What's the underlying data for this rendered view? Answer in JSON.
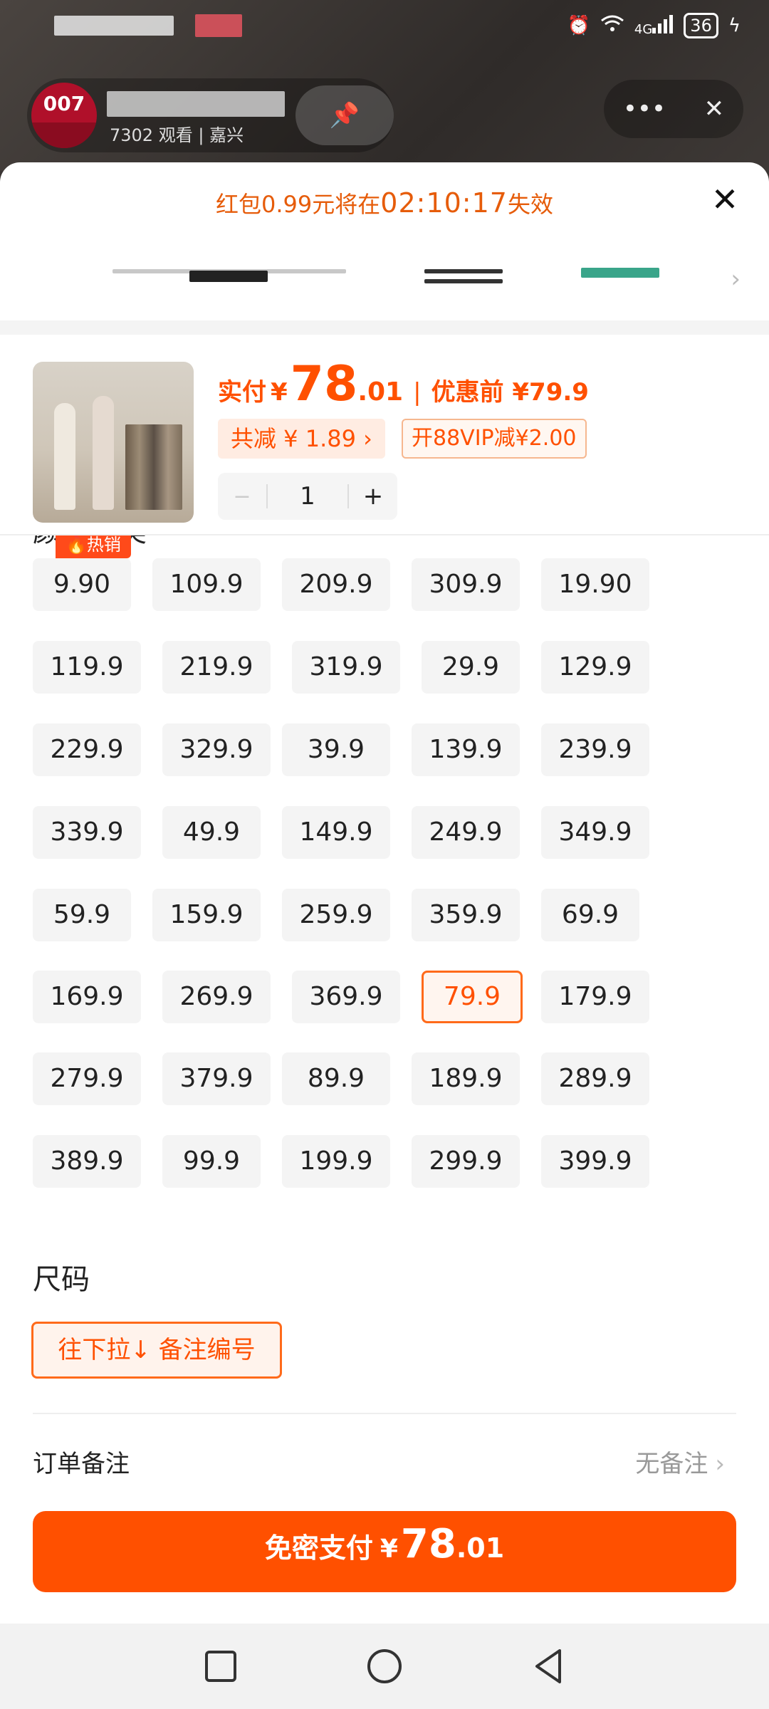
{
  "status_bar": {
    "battery": "36",
    "network": "4G"
  },
  "live_header": {
    "avatar_text": "007",
    "viewers": "7302 观看",
    "location": "嘉兴"
  },
  "sheet": {
    "red_packet_prefix": "红包0.99元将在",
    "countdown": "02:10:17",
    "red_packet_suffix": "失效"
  },
  "product": {
    "pay_label": "实付",
    "currency": "¥",
    "price_int": "78",
    "price_dec": ".01",
    "separator": "|",
    "original_price": "优惠前 ¥79.9",
    "discount_chip": "共减 ¥ 1.89 ›",
    "vip_chip": "开88VIP减¥2.00",
    "quantity": "1",
    "minus": "−",
    "plus": "+"
  },
  "options": {
    "hot_badge": "🔥热销",
    "selected": "79.9",
    "items": [
      "9.90",
      "109.9",
      "209.9",
      "309.9",
      "19.90",
      "119.9",
      "219.9",
      "319.9",
      "29.9",
      "129.9",
      "229.9",
      "329.9",
      "39.9",
      "139.9",
      "239.9",
      "339.9",
      "49.9",
      "149.9",
      "249.9",
      "349.9",
      "59.9",
      "159.9",
      "259.9",
      "359.9",
      "69.9",
      "169.9",
      "269.9",
      "369.9",
      "79.9",
      "179.9",
      "279.9",
      "379.9",
      "89.9",
      "189.9",
      "289.9",
      "389.9",
      "99.9",
      "199.9",
      "299.9",
      "399.9"
    ]
  },
  "size": {
    "title": "尺码",
    "chip": "往下拉↓ 备注编号"
  },
  "remark": {
    "label": "订单备注",
    "value": "无备注",
    "chevron": "›"
  },
  "pay_button": {
    "label": "免密支付",
    "currency": "¥",
    "int": "78",
    "dec": ".01"
  },
  "colors": {
    "accent": "#ff5000",
    "chip_bg": "#f4f4f4",
    "selected_bg": "#fff5ef"
  }
}
